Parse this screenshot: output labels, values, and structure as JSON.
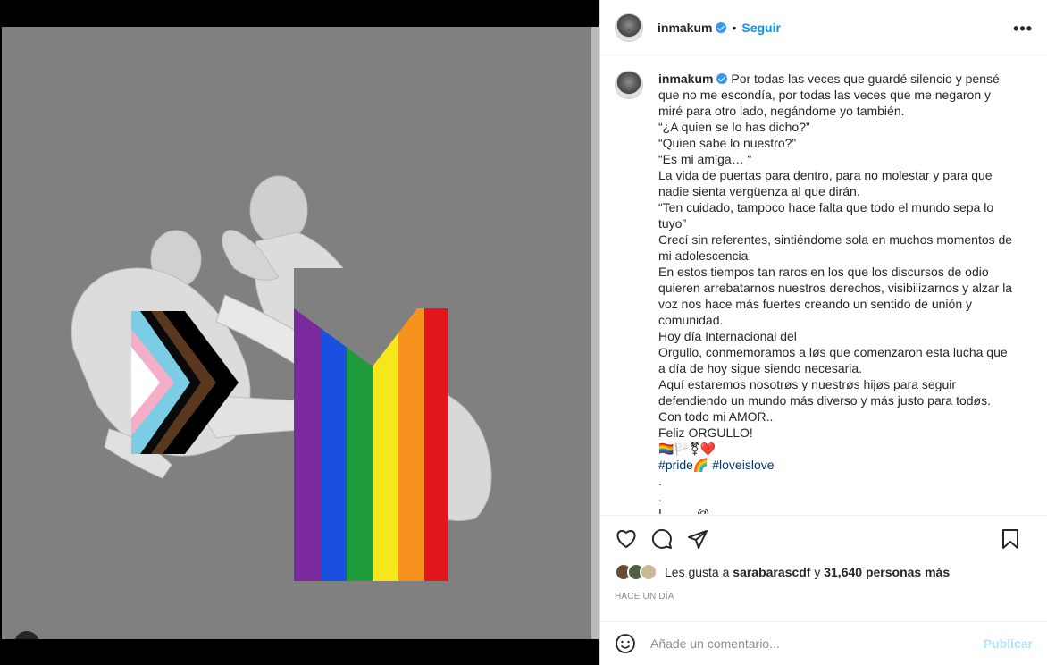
{
  "post": {
    "username": "inmakum",
    "follow_label": "Seguir",
    "dot": "•",
    "more_label": "•••"
  },
  "caption": {
    "username": "inmakum",
    "lines": [
      "Por todas las veces que guardé silencio y pensé que no me escondía, por todas las veces que me negaron y miré para otro lado, negándome yo también.",
      "“¿A quien se lo has dicho?”",
      "“Quien sabe lo nuestro?”",
      "“Es mi amiga… “",
      "La vida de puertas para dentro, para no molestar y para que nadie sienta vergüenza al que dirán.",
      "“Ten cuidado, tampoco hace falta que todo el mundo sepa lo tuyo”",
      "Crecí sin referentes, sintiéndome sola en muchos momentos de mi adolescencia.",
      "En estos tiempos tan raros en los que los discursos de odio quieren arrebatarnos nuestros derechos, visibilizarnos y alzar la voz nos hace más fuertes creando un sentido de unión y comunidad.",
      "Hoy día Internacional del",
      "Orgullo, conmemoramos a løs que comenzaron esta lucha que a día de hoy sigue siendo necesaria.",
      "Aquí estaremos nosotrøs y nuestrøs hijøs para seguir defendiendo un mundo más diverso y más justo para todøs.",
      "Con todo mi AMOR..",
      "Feliz ORGULLO!"
    ],
    "emoji_line": "🏳️‍🌈🏳️⚧❤️",
    "hashtag1": "#pride🌈",
    "hashtag2": "#loveislove",
    "dot_line1": ".",
    "dot_line2": ".",
    "cut_line": "I ........ @............"
  },
  "likes": {
    "prefix": "Les gusta a",
    "user": "sarabarascdf",
    "connector": "y",
    "count": "31,640 personas más"
  },
  "timestamp": "HACE UN DÍA",
  "comment": {
    "placeholder": "Añade un comentario...",
    "publish_label": "Publicar"
  },
  "colors": {
    "accent": "#0095f6",
    "publish_disabled": "#b2dffc",
    "image_bg": "#808080"
  },
  "icons": [
    "person-icon",
    "heart-icon",
    "comment-icon",
    "share-icon",
    "bookmark-icon",
    "emoji-icon",
    "more-icon",
    "verified-icon"
  ]
}
